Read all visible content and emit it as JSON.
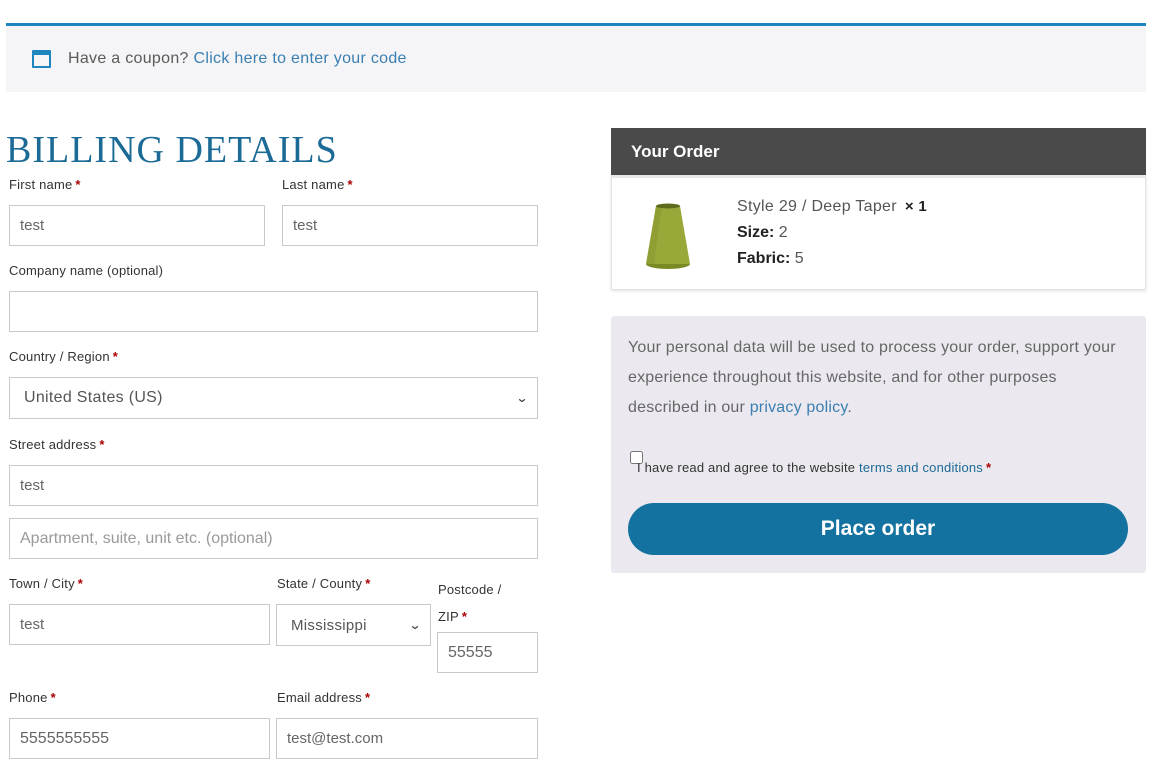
{
  "coupon": {
    "prompt": "Have a coupon? ",
    "link": "Click here to enter your code"
  },
  "billing": {
    "title": "BILLING DETAILS",
    "first_name": {
      "label": "First name",
      "value": "test"
    },
    "last_name": {
      "label": "Last name",
      "value": "test"
    },
    "company": {
      "label": "Company name (optional)",
      "value": ""
    },
    "country": {
      "label": "Country / Region",
      "value": "United States (US)"
    },
    "street": {
      "label": "Street address",
      "value": "test",
      "placeholder2": "Apartment, suite, unit etc. (optional)"
    },
    "city": {
      "label": "Town / City",
      "value": "test"
    },
    "state": {
      "label": "State / County",
      "value": "Mississippi"
    },
    "postcode": {
      "label_line1": "Postcode /",
      "label_line2": "ZIP",
      "value": "55555"
    },
    "phone": {
      "label": "Phone",
      "value": "5555555555"
    },
    "email": {
      "label": "Email address",
      "value": "test@test.com"
    },
    "required_mark": "*"
  },
  "order": {
    "title": "Your Order",
    "item": {
      "name": "Style 29 / Deep Taper",
      "qty": "× 1",
      "size_label": "Size:",
      "size_value": " 2",
      "fabric_label": "Fabric:",
      "fabric_value": " 5"
    }
  },
  "terms": {
    "privacy_text": "Your personal data will be used to process your order, support your experience throughout this website, and for other purposes described in our ",
    "privacy_link": "privacy policy",
    "privacy_end": ".",
    "agree_text": "I have read and agree to the website ",
    "terms_link": "terms and conditions",
    "place_order": "Place order"
  },
  "colors": {
    "accent": "#1e85be",
    "button": "#13729f",
    "header_bg": "#4a4a4a",
    "product": "#9aa83a"
  }
}
